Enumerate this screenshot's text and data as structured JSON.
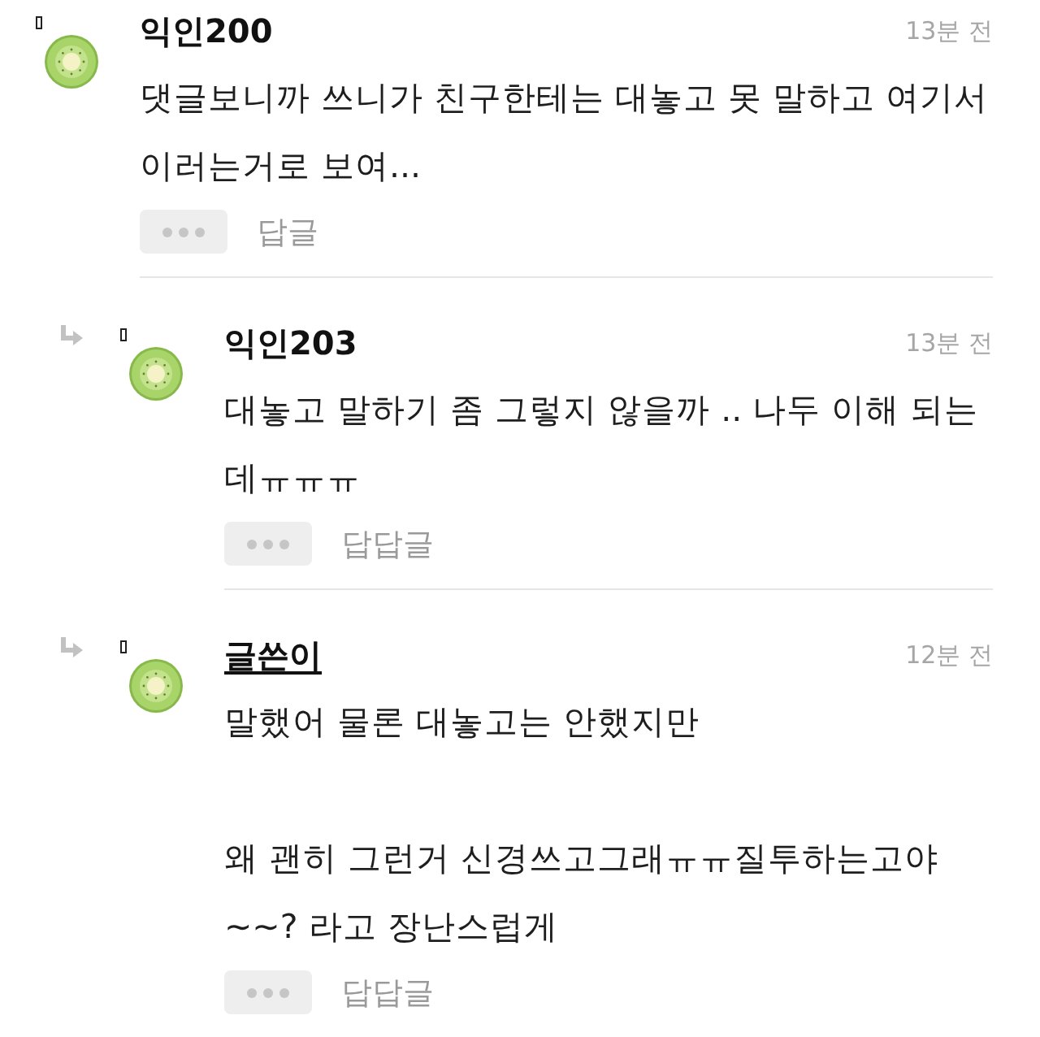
{
  "comments": [
    {
      "kind": "comment",
      "author": "익인200",
      "underlined": false,
      "time": "13분 전",
      "body": "댓글보니까 쓰니가 친구한테는 대놓고 못 말하고 여기서 이러는거로 보여...",
      "reply_label": "답글"
    },
    {
      "kind": "reply",
      "author": "익인203",
      "underlined": false,
      "time": "13분 전",
      "body": "대놓고 말하기 좀 그렇지 않을까 .. 나두 이해 되는데ㅠㅠㅠ",
      "reply_label": "답답글"
    },
    {
      "kind": "reply",
      "author": "글쓴이",
      "underlined": true,
      "time": "12분 전",
      "body": "말했어 물론 대놓고는 안했지만\n\n왜 괜히 그런거 신경쓰고그래ㅠㅠ질투하는고야~~? 라고 장난스럽게",
      "reply_label": "답답글"
    }
  ]
}
